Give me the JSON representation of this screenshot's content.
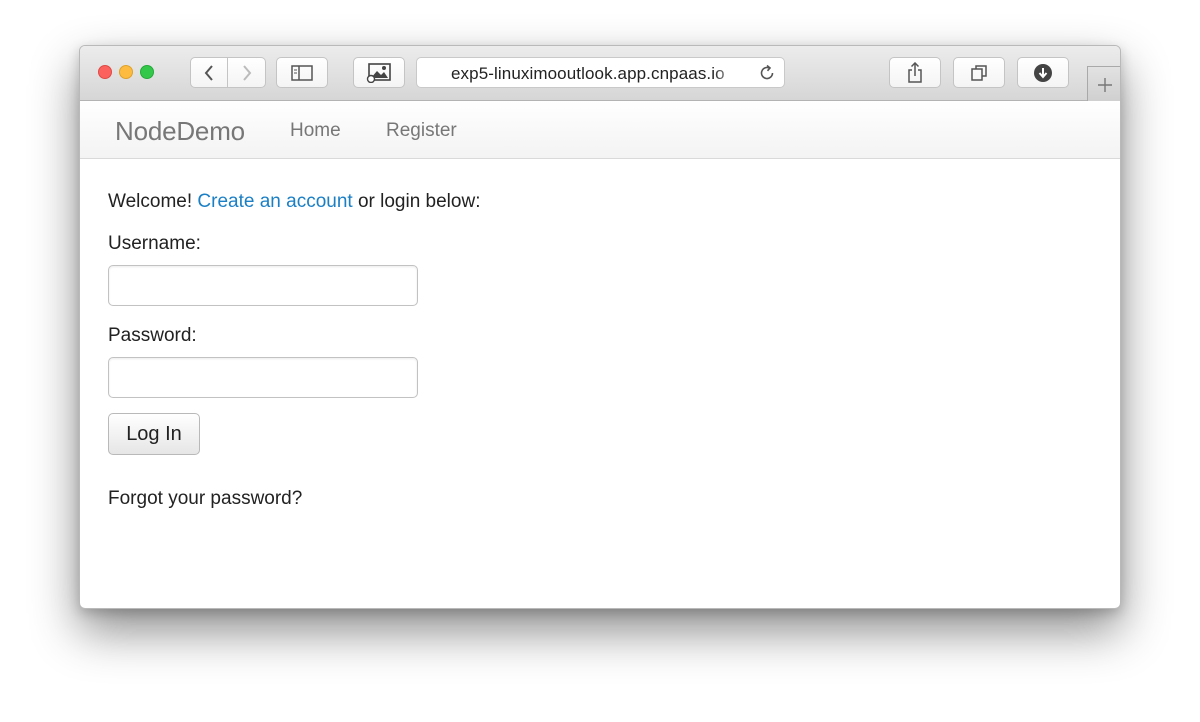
{
  "browser": {
    "address": "exp5-linuximooutlook.app.cnpaas.io",
    "icons": {
      "back": "chevron-left-icon",
      "forward": "chevron-right-icon",
      "sidebar": "sidebar-icon",
      "image": "image-icon",
      "reload": "reload-icon",
      "share": "share-icon",
      "tabs": "tabs-icon",
      "download": "download-icon",
      "new_tab": "plus-icon"
    },
    "colors": {
      "close": "#fc615d",
      "minimize": "#fdbc40",
      "zoom": "#34c84a"
    }
  },
  "navbar": {
    "brand": "NodeDemo",
    "links": [
      "Home",
      "Register"
    ]
  },
  "login": {
    "welcome_prefix": "Welcome!",
    "create_account_link": "Create an account",
    "welcome_suffix": "or login below:",
    "username_label": "Username:",
    "password_label": "Password:",
    "submit_label": "Log In",
    "forgot_link": "Forgot your password?"
  },
  "colors": {
    "link": "#1b7fc5",
    "nav_text": "#777777"
  }
}
